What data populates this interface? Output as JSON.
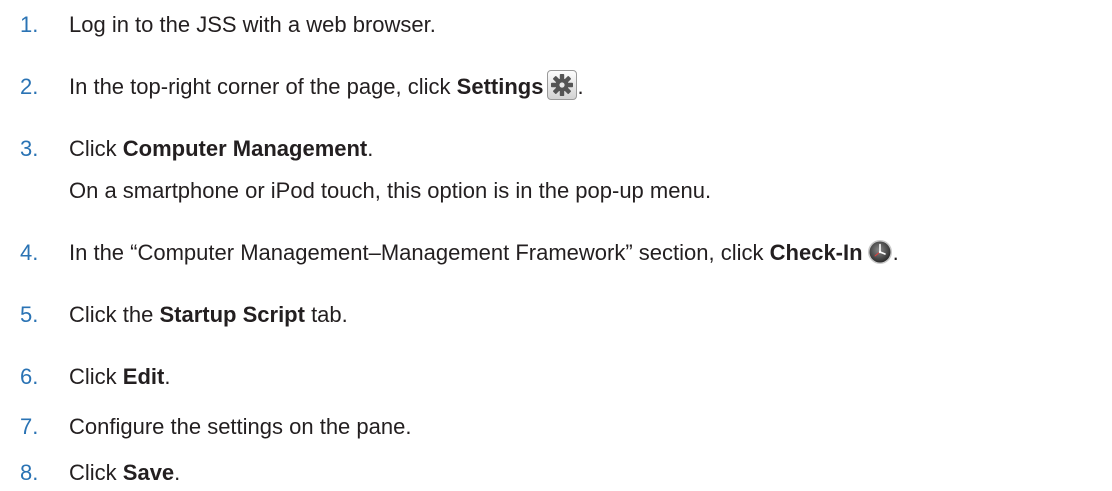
{
  "steps": [
    {
      "number": "1.",
      "text": "Log in to the JSS with a web browser."
    },
    {
      "number": "2.",
      "pre": "In the top-right corner of the page, click ",
      "bold": "Settings",
      "icon": "gear-icon",
      "post": "."
    },
    {
      "number": "3.",
      "pre": "Click ",
      "bold": "Computer Management",
      "post": ".",
      "note": "On a smartphone or iPod touch, this option is in the pop-up menu."
    },
    {
      "number": "4.",
      "pre": "In the “Computer Management–Management Framework” section, click ",
      "bold": "Check-In",
      "icon": "clock-icon",
      "post": "."
    },
    {
      "number": "5.",
      "pre": "Click the ",
      "bold": "Startup Script",
      "post": " tab."
    },
    {
      "number": "6.",
      "pre": "Click ",
      "bold": "Edit",
      "post": "."
    },
    {
      "number": "7.",
      "text": "Configure the settings on the pane."
    },
    {
      "number": "8.",
      "pre": "Click ",
      "bold": "Save",
      "post": "."
    }
  ],
  "colors": {
    "step_number": "#2a73b4",
    "body_text": "#231f20"
  }
}
